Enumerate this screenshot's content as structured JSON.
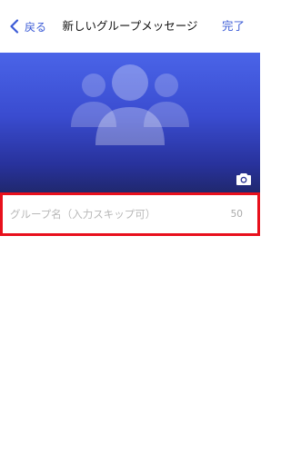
{
  "navbar": {
    "back_label": "戻る",
    "title": "新しいグループメッセージ",
    "done_label": "完了"
  },
  "cover": {
    "placeholder_icon": "group-icon",
    "camera_icon": "camera-icon",
    "gradient_colors": [
      "#4a64e8",
      "#20286e"
    ]
  },
  "group_name": {
    "value": "",
    "placeholder": "グループ名（入力スキップ可）",
    "max_length": "50"
  },
  "colors": {
    "accent": "#3b5bd6",
    "highlight": "#e8101c"
  }
}
